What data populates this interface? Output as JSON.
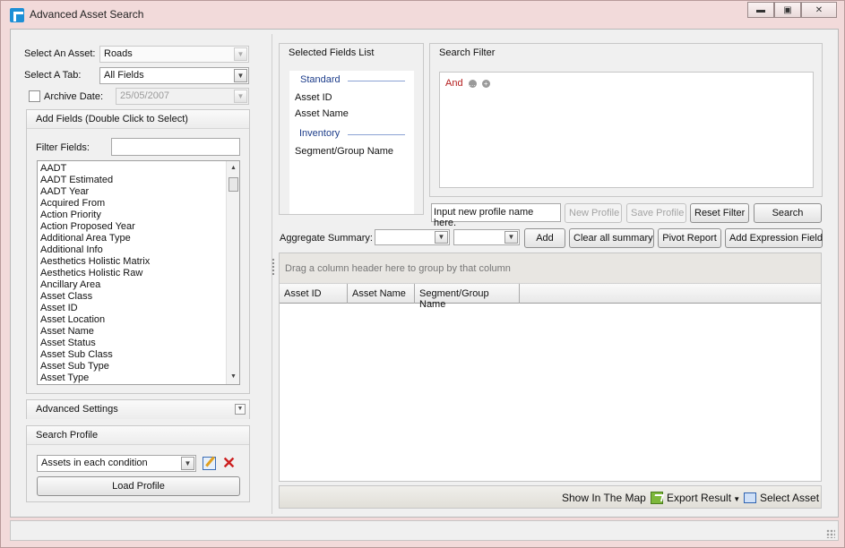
{
  "window": {
    "title": "Advanced Asset Search"
  },
  "left": {
    "select_asset_label": "Select An Asset:",
    "select_asset_value": "Roads",
    "select_tab_label": "Select A Tab:",
    "select_tab_value": "All Fields",
    "archive_date_label": "Archive Date:",
    "archive_date_value": "25/05/2007",
    "archive_checked": false,
    "add_fields_header": "Add Fields (Double Click to Select)",
    "filter_fields_label": "Filter Fields:",
    "filter_fields_value": "",
    "fields": [
      "AADT",
      "AADT Estimated",
      "AADT Year",
      "Acquired From",
      "Action Priority",
      "Action Proposed Year",
      "Additional Area Type",
      "Additional Info",
      "Aesthetics Holistic Matrix",
      "Aesthetics Holistic Raw",
      "Ancillary Area",
      "Asset Class",
      "Asset ID",
      "Asset Location",
      "Asset Name",
      "Asset Status",
      "Asset Sub Class",
      "Asset Sub Type",
      "Asset Type"
    ],
    "advanced_settings_header": "Advanced Settings",
    "search_profile_header": "Search Profile",
    "profile_value": "Assets in each condition",
    "load_profile_label": "Load Profile"
  },
  "selected_fields": {
    "header": "Selected Fields List",
    "standard_label": "Standard",
    "standard_items": [
      "Asset ID",
      "Asset Name"
    ],
    "inventory_label": "Inventory",
    "inventory_items": [
      "Segment/Group Name"
    ]
  },
  "search_filter": {
    "header": "Search Filter",
    "operator": "And"
  },
  "profile_bar": {
    "profile_name_input": "Input new profile name here.",
    "new_profile_label": "New Profile",
    "save_profile_label": "Save Profile",
    "reset_filter_label": "Reset Filter",
    "search_label": "Search"
  },
  "aggregate": {
    "label": "Aggregate Summary:",
    "select1_value": "",
    "select2_value": "",
    "add_label": "Add",
    "clear_label": "Clear all summary",
    "pivot_label": "Pivot Report",
    "add_expression_label": "Add Expression Field"
  },
  "grid": {
    "group_by_hint": "Drag a column header here to group by that column",
    "columns": [
      "Asset ID",
      "Asset Name",
      "Segment/Group Name"
    ]
  },
  "bottom": {
    "show_map_label": "Show In The Map",
    "export_label": "Export Result",
    "select_asset_label": "Select Asset"
  }
}
